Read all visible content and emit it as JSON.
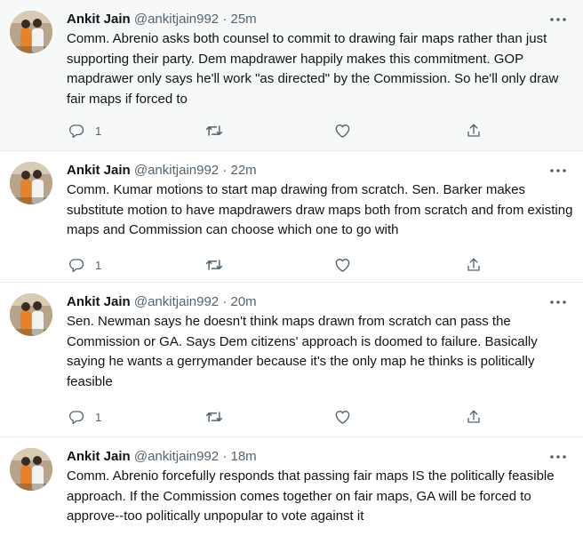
{
  "tweets": [
    {
      "name": "Ankit Jain",
      "handle": "@ankitjain992",
      "separator": "·",
      "time": "25m",
      "text": "Comm. Abrenio asks both counsel to commit to drawing fair maps rather than just supporting their party. Dem mapdrawer happily makes this commitment. GOP mapdrawer only says he'll work \"as directed\" by the Commission. So he'll only draw fair maps if forced to",
      "reply_count": "1"
    },
    {
      "name": "Ankit Jain",
      "handle": "@ankitjain992",
      "separator": "·",
      "time": "22m",
      "text": "Comm. Kumar motions to start map drawing from scratch. Sen. Barker makes substitute motion to have mapdrawers draw maps both from scratch and from existing maps and Commission can choose which one to go with",
      "reply_count": "1"
    },
    {
      "name": "Ankit Jain",
      "handle": "@ankitjain992",
      "separator": "·",
      "time": "20m",
      "text": "Sen. Newman says he doesn't think maps drawn from scratch can pass the Commission or GA. Says Dem citizens' approach is doomed to failure. Basically saying he wants a gerrymander because it's the only map he thinks is politically feasible",
      "reply_count": "1"
    },
    {
      "name": "Ankit Jain",
      "handle": "@ankitjain992",
      "separator": "·",
      "time": "18m",
      "text": "Comm. Abrenio forcefully responds that passing fair maps IS the politically feasible approach. If the Commission comes together on fair maps, GA will be forced to approve--too politically unpopular to vote against it",
      "reply_count": ""
    }
  ],
  "icons": {
    "reply": "reply-icon",
    "retweet": "retweet-icon",
    "like": "like-icon",
    "share": "share-icon",
    "more": "more-icon"
  },
  "colors": {
    "icon": "#536471",
    "border": "#e6ecf0",
    "highlight_bg": "#f7f9f9"
  }
}
